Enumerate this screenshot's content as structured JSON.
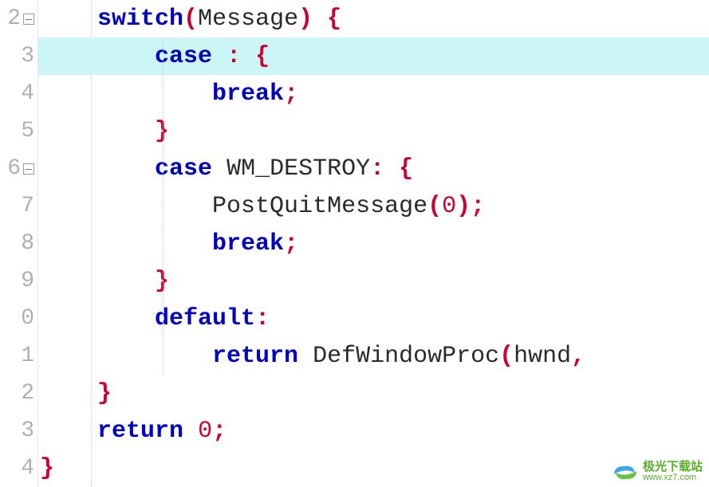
{
  "gutter": {
    "start_partial": "2",
    "lines": [
      "2",
      "3",
      "4",
      "5",
      "6",
      "7",
      "8",
      "9",
      "0",
      "1",
      "2",
      "3",
      "4"
    ]
  },
  "code": {
    "l1": {
      "kw": "switch",
      "lp": "(",
      "id": "Message",
      "rp": ")",
      "sp": " ",
      "ob": "{"
    },
    "l2": {
      "pad": "    ",
      "kw": "case",
      "sp": " ",
      "col": ":",
      "sp2": " ",
      "ob": "{"
    },
    "l3": {
      "pad": "        ",
      "kw": "break",
      "sc": ";"
    },
    "l4": {
      "pad": "    ",
      "cb": "}"
    },
    "l5": {
      "pad": "    ",
      "kw": "case",
      "sp": " ",
      "id": "WM_DESTROY",
      "col": ":",
      "sp2": " ",
      "ob": "{"
    },
    "l6": {
      "pad": "        ",
      "id": "PostQuitMessage",
      "lp": "(",
      "nm": "0",
      "rp": ")",
      "sc": ";"
    },
    "l7": {
      "pad": "        ",
      "kw": "break",
      "sc": ";"
    },
    "l8": {
      "pad": "    ",
      "cb": "}"
    },
    "l9": {
      "pad": "    ",
      "kw": "default",
      "col": ":"
    },
    "l10": {
      "pad": "        ",
      "kw": "return",
      "sp": " ",
      "id": "DefWindowProc",
      "lp": "(",
      "arg": "hwnd",
      "cm": ","
    },
    "l11": {
      "cb": "}"
    },
    "l12": {
      "kw": "return",
      "sp": " ",
      "nm": "0",
      "sc": ";"
    },
    "l13": {
      "cb": "}"
    }
  },
  "watermark": {
    "title": "极光下载站",
    "url": "www.xz7.com"
  },
  "indent_unit": "    "
}
